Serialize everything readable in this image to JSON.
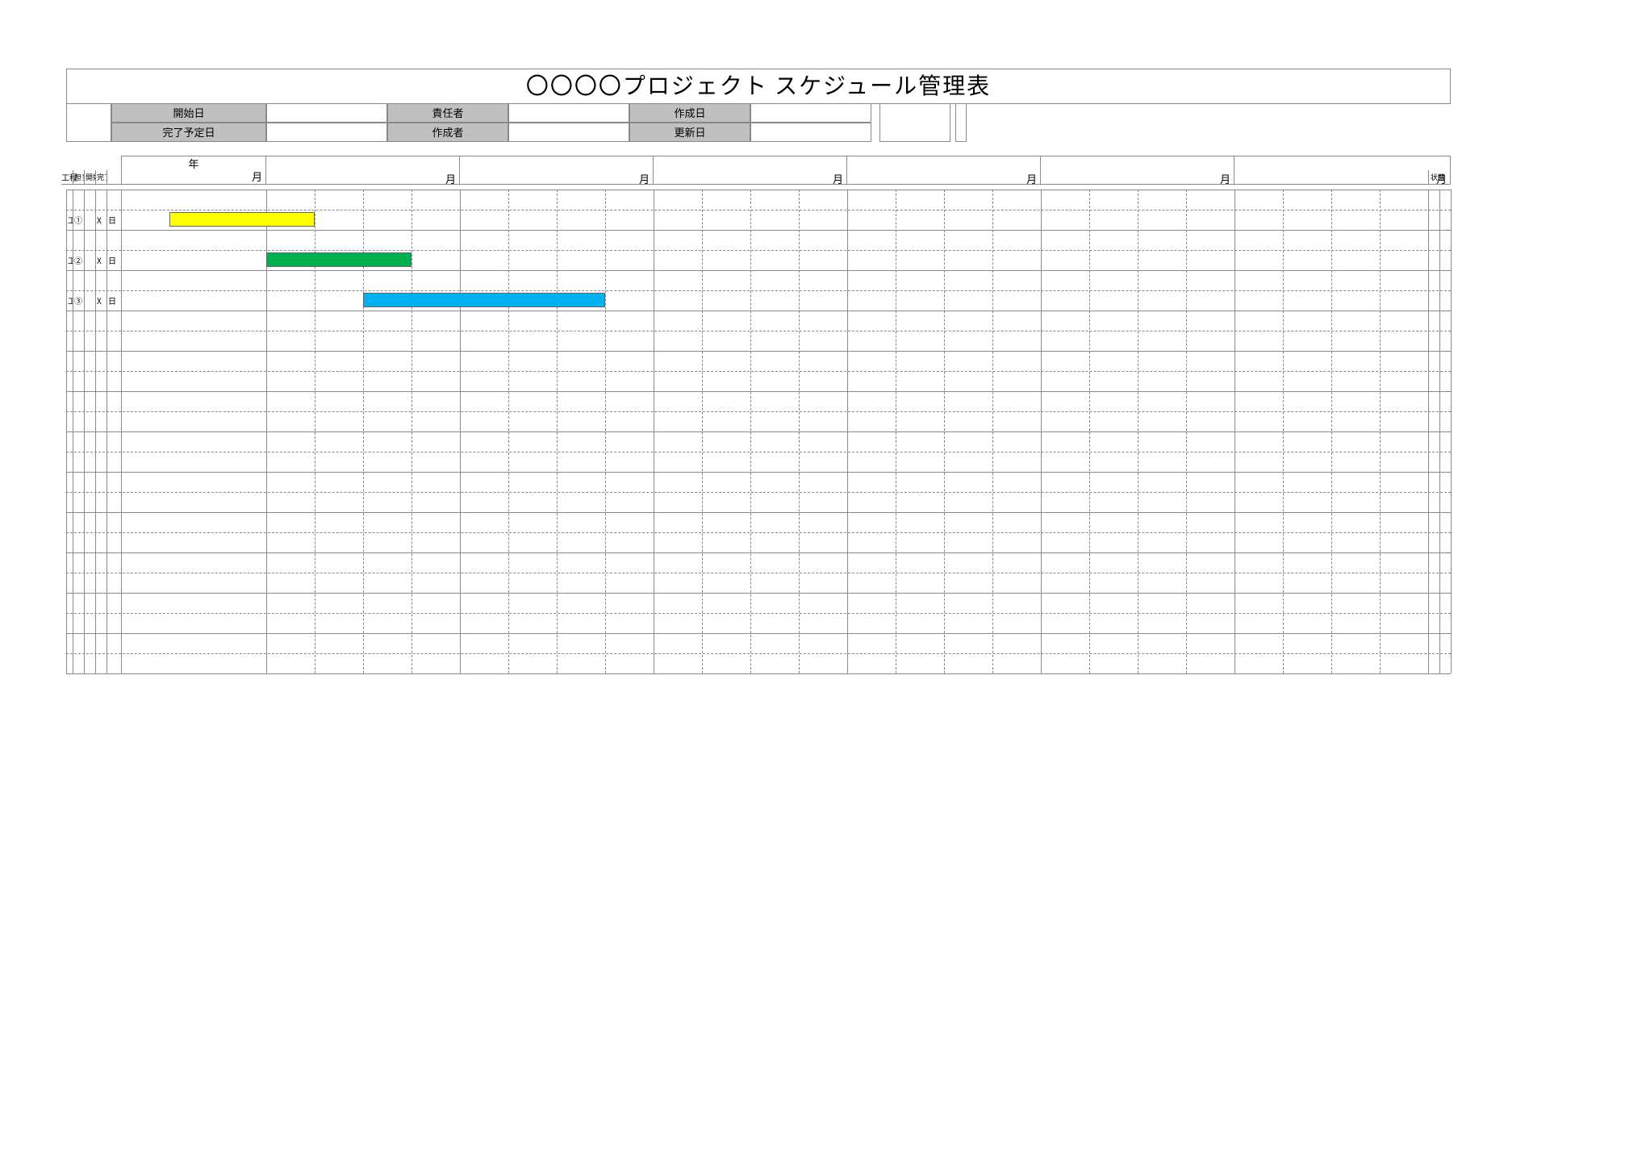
{
  "title": "〇〇〇〇プロジェクト スケジュール管理表",
  "meta": {
    "row0": [
      {
        "label": "開始日",
        "value": ""
      },
      {
        "label": "責任者",
        "value": ""
      },
      {
        "label": "作成日",
        "value": ""
      }
    ],
    "row1": [
      {
        "label": "完了予定日",
        "value": ""
      },
      {
        "label": "作成者",
        "value": ""
      },
      {
        "label": "更新日",
        "value": ""
      }
    ]
  },
  "header": {
    "process_col": "工程",
    "tiny_cols": [
      "担当",
      "開始",
      "完了",
      ""
    ],
    "year": "年",
    "month_unit": "月",
    "status_col": "状態"
  },
  "tasks": [
    {
      "code_parts": [
        "工程",
        "①",
        "",
        "X",
        "日"
      ],
      "row_index": 1,
      "bar_start_week": 1,
      "bar_span_weeks": 3,
      "color": "#ffff00"
    },
    {
      "code_parts": [
        "工程",
        "②",
        "",
        "X",
        "日"
      ],
      "row_index": 3,
      "bar_start_week": 3,
      "bar_span_weeks": 3,
      "color": "#00b050"
    },
    {
      "code_parts": [
        "工程",
        "③",
        "",
        "X",
        "日"
      ],
      "row_index": 5,
      "bar_start_week": 5,
      "bar_span_weeks": 5,
      "color": "#00b0f0"
    }
  ],
  "chart_data": {
    "type": "bar",
    "title": "〇〇〇〇プロジェクト スケジュール管理表",
    "xlabel": "月",
    "ylabel": "工程",
    "x_units": "週 (各月4分割)",
    "categories": [
      "工程①",
      "工程②",
      "工程③"
    ],
    "series": [
      {
        "name": "工程①",
        "start_week": 1,
        "end_week": 4,
        "color": "#ffff00"
      },
      {
        "name": "工程②",
        "start_week": 3,
        "end_week": 6,
        "color": "#00b050"
      },
      {
        "name": "工程③",
        "start_week": 5,
        "end_week": 10,
        "color": "#00b0f0"
      }
    ],
    "x_ticks_months": [
      "月",
      "月",
      "月",
      "月",
      "月",
      "月"
    ],
    "weeks_per_month": 4,
    "xlim_weeks": [
      0,
      24
    ]
  },
  "layout": {
    "main_row_count": 9,
    "leading_rows": 6,
    "rows_per_task": 2,
    "months": 6
  }
}
